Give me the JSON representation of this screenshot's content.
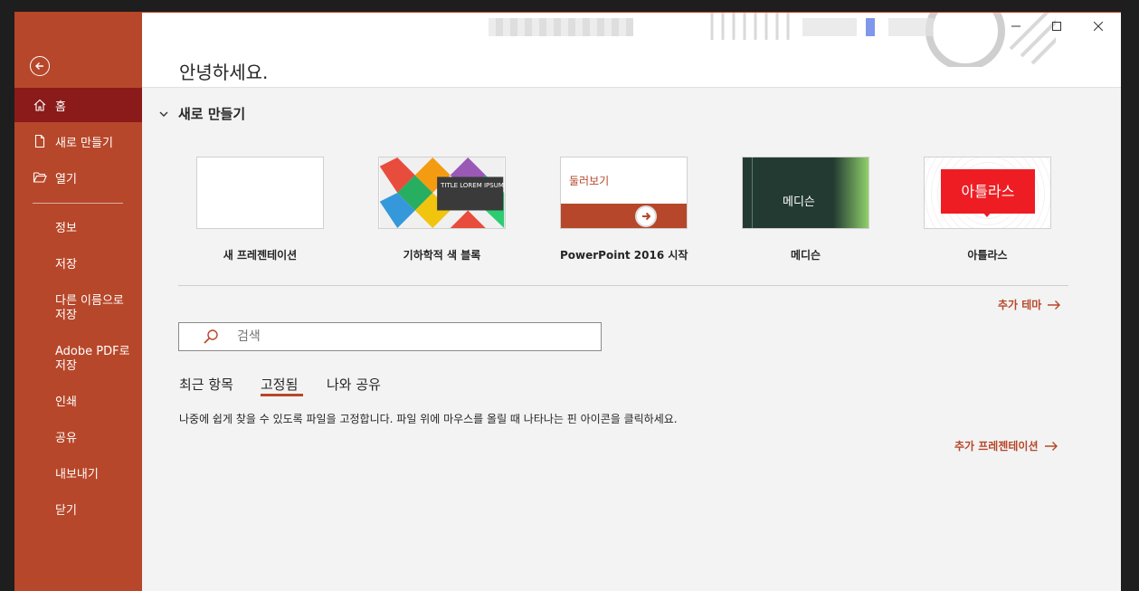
{
  "sidebar": {
    "back_icon": "back-arrow-icon",
    "items": [
      {
        "label": "홈",
        "icon": "home-icon"
      },
      {
        "label": "새로 만들기",
        "icon": "new-document-icon"
      },
      {
        "label": "열기",
        "icon": "folder-open-icon"
      }
    ],
    "plain_items": [
      "정보",
      "저장",
      "다른 이름으로 저장",
      "Adobe PDF로 저장",
      "인쇄",
      "공유",
      "내보내기",
      "닫기"
    ],
    "accent": "#b7472a",
    "active_bg": "#8b1a1a"
  },
  "header": {
    "greeting": "안녕하세요."
  },
  "new_section": {
    "title": "새로 만들기",
    "templates": [
      {
        "label": "새 프레젠테이션"
      },
      {
        "label": "기하학적 색 블록",
        "thumb_text": "TITLE LOREM IPSUM"
      },
      {
        "label": "PowerPoint 2016 시작",
        "thumb_text": "둘러보기"
      },
      {
        "label": "메디슨",
        "thumb_text": "메디슨"
      },
      {
        "label": "아틀라스",
        "thumb_text": "아틀라스"
      }
    ],
    "more_themes": "추가 테마"
  },
  "search": {
    "placeholder": "검색"
  },
  "tabs": {
    "recent": "최근 항목",
    "pinned": "고정됨",
    "shared": "나와 공유"
  },
  "pinned_hint": "나중에 쉽게 찾을 수 있도록 파일을 고정합니다. 파일 위에 마우스를 올릴 때 나타나는 핀 아이콘을 클릭하세요.",
  "more_presentations": "추가 프레젠테이션"
}
